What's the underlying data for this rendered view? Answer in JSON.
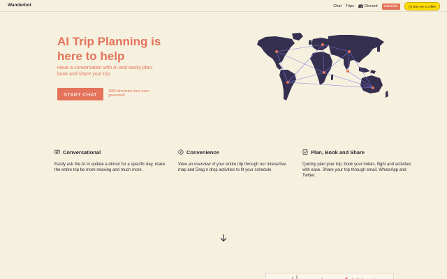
{
  "header": {
    "brand": "Wanderbot",
    "nav": {
      "chat": "Chat",
      "trips": "Trips",
      "discord": "Discord",
      "subscribe": "Subscribe",
      "coffee": "Buy me a coffee"
    }
  },
  "hero": {
    "title": "AI Trip Planning is here to help",
    "subtitle": "Have a conversation with AI and easily plan, book and share your trip",
    "cta": "START CHAT",
    "note": "1000 itineraries have been generated!"
  },
  "features": [
    {
      "icon": "chat-icon",
      "title": "Conversational",
      "description": "Easily ask the AI to update a dinner for a specific day, make the entire trip be more relaxing and much more."
    },
    {
      "icon": "compass-icon",
      "title": "Convenience",
      "description": "View an overview of your entire trip through our interactive map and Drag n drop activities to fit your schedule."
    },
    {
      "icon": "book-share-icon",
      "title": "Plan, Book and Share",
      "description": "Quickly plan your trip, book your hotels, flight and activities with ease. Share your trip through email, WhatsApp and Twitter."
    }
  ],
  "icons": {
    "scroll": "arrow-down-icon",
    "discord": "discord-icon",
    "coffee": "coffee-cup-icon"
  },
  "colors": {
    "background": "#f6f1df",
    "accent": "#e3735a",
    "map_land": "#35304f",
    "map_routes": "#7b79e6",
    "coffee_button": "#ffdd00"
  }
}
